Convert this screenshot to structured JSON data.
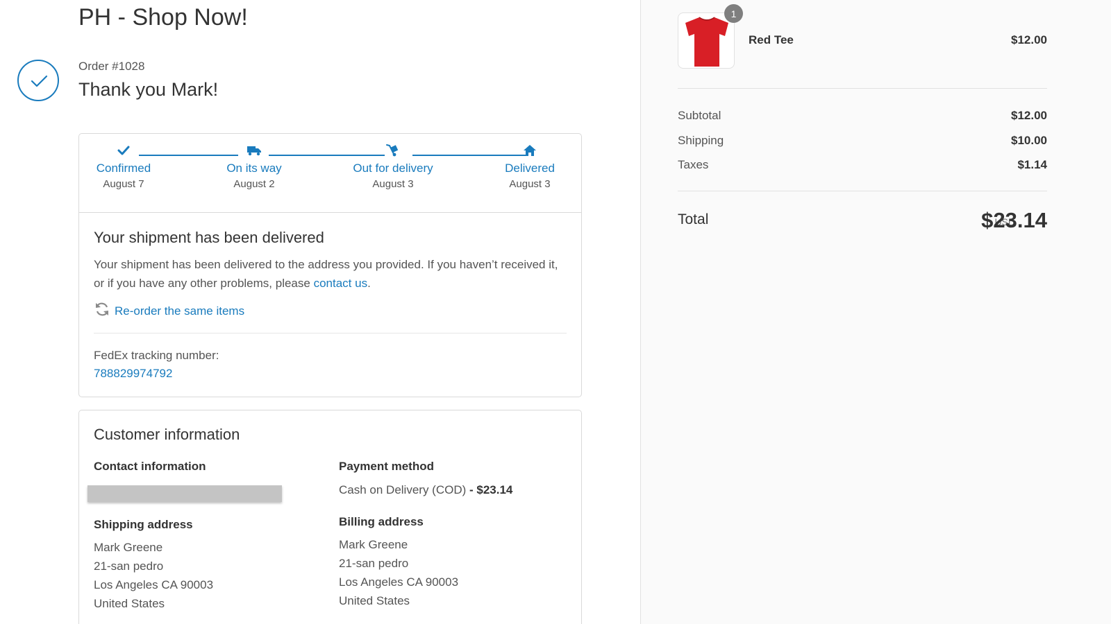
{
  "shop": {
    "title": "PH - Shop Now!"
  },
  "order": {
    "number": "Order #1028",
    "thank_you": "Thank you Mark!"
  },
  "colors": {
    "accent": "#197bbd",
    "text": "#333333",
    "muted": "#545454",
    "sidebar_bg": "#fafafa",
    "product": "#d81f26"
  },
  "progress": {
    "steps": [
      {
        "label": "Confirmed",
        "date": "August 7",
        "icon": "checkmark-icon"
      },
      {
        "label": "On its way",
        "date": "August 2",
        "icon": "truck-icon"
      },
      {
        "label": "Out for delivery",
        "date": "August 3",
        "icon": "hand-truck-icon"
      },
      {
        "label": "Delivered",
        "date": "August 3",
        "icon": "house-icon"
      }
    ]
  },
  "shipment": {
    "heading": "Your shipment has been delivered",
    "text_before": "Your shipment has been delivered to the address you provided. If you haven’t received it, or if you have any other problems, please ",
    "contact_link": "contact us",
    "text_after": ".",
    "reorder_label": "Re-order the same items",
    "tracking_label": "FedEx tracking number:",
    "tracking_number": "788829974792"
  },
  "customer": {
    "heading": "Customer information",
    "contact_heading": "Contact information",
    "payment_heading": "Payment method",
    "payment_method": "Cash on Delivery (COD)",
    "payment_amount": " - $23.14",
    "shipping_heading": "Shipping address",
    "shipping_lines": [
      "Mark Greene",
      "21-san pedro",
      "Los Angeles CA 90003",
      "United States"
    ],
    "billing_heading": "Billing address",
    "billing_lines": [
      "Mark Greene",
      "21-san pedro",
      "Los Angeles CA 90003",
      "United States"
    ]
  },
  "summary": {
    "item": {
      "name": "Red Tee",
      "price": "$12.00",
      "quantity": "1",
      "image_icon": "red-tshirt-icon"
    },
    "subtotal_label": "Subtotal",
    "subtotal": "$12.00",
    "shipping_label": "Shipping",
    "shipping": "$10.00",
    "taxes_label": "Taxes",
    "taxes": "$1.14",
    "total_label": "Total",
    "currency": "USD",
    "total": "$23.14"
  }
}
